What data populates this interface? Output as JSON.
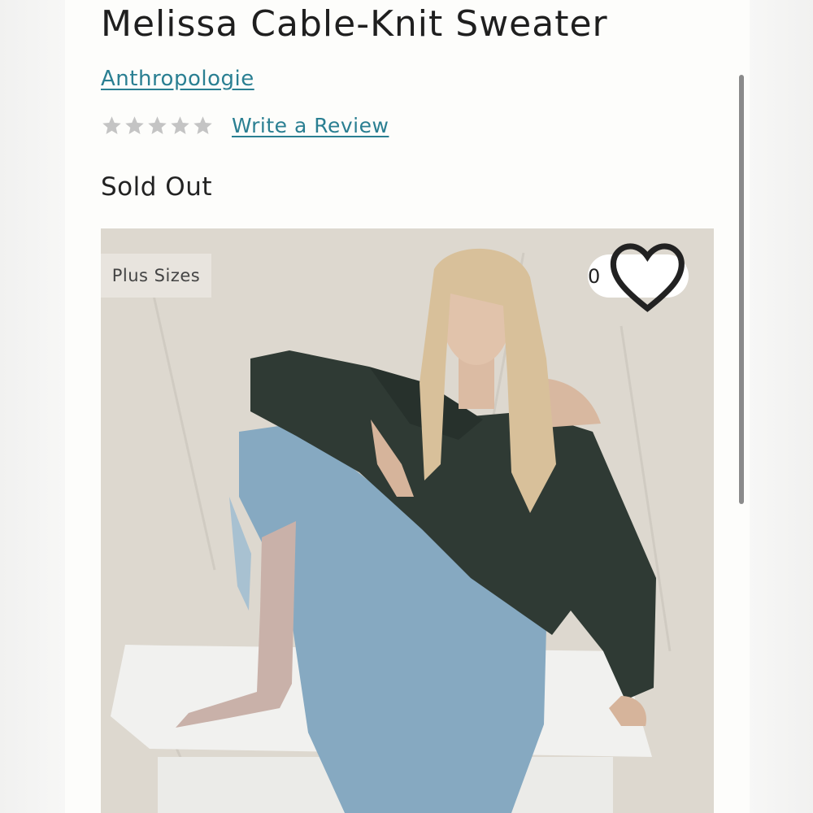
{
  "product": {
    "title": "Melissa Cable-Knit Sweater",
    "brand": "Anthropologie",
    "rating": {
      "stars_filled": 0,
      "stars_total": 5,
      "star_color": "#c4c4c4"
    },
    "write_review_label": "Write a Review",
    "availability": "Sold Out"
  },
  "image": {
    "badge_label": "Plus Sizes",
    "favorite_count": "0",
    "favorite_icon": "heart-icon"
  },
  "colors": {
    "link": "#2a7f92",
    "text": "#1f1f1f",
    "panel_background": "#fdfdfb"
  }
}
